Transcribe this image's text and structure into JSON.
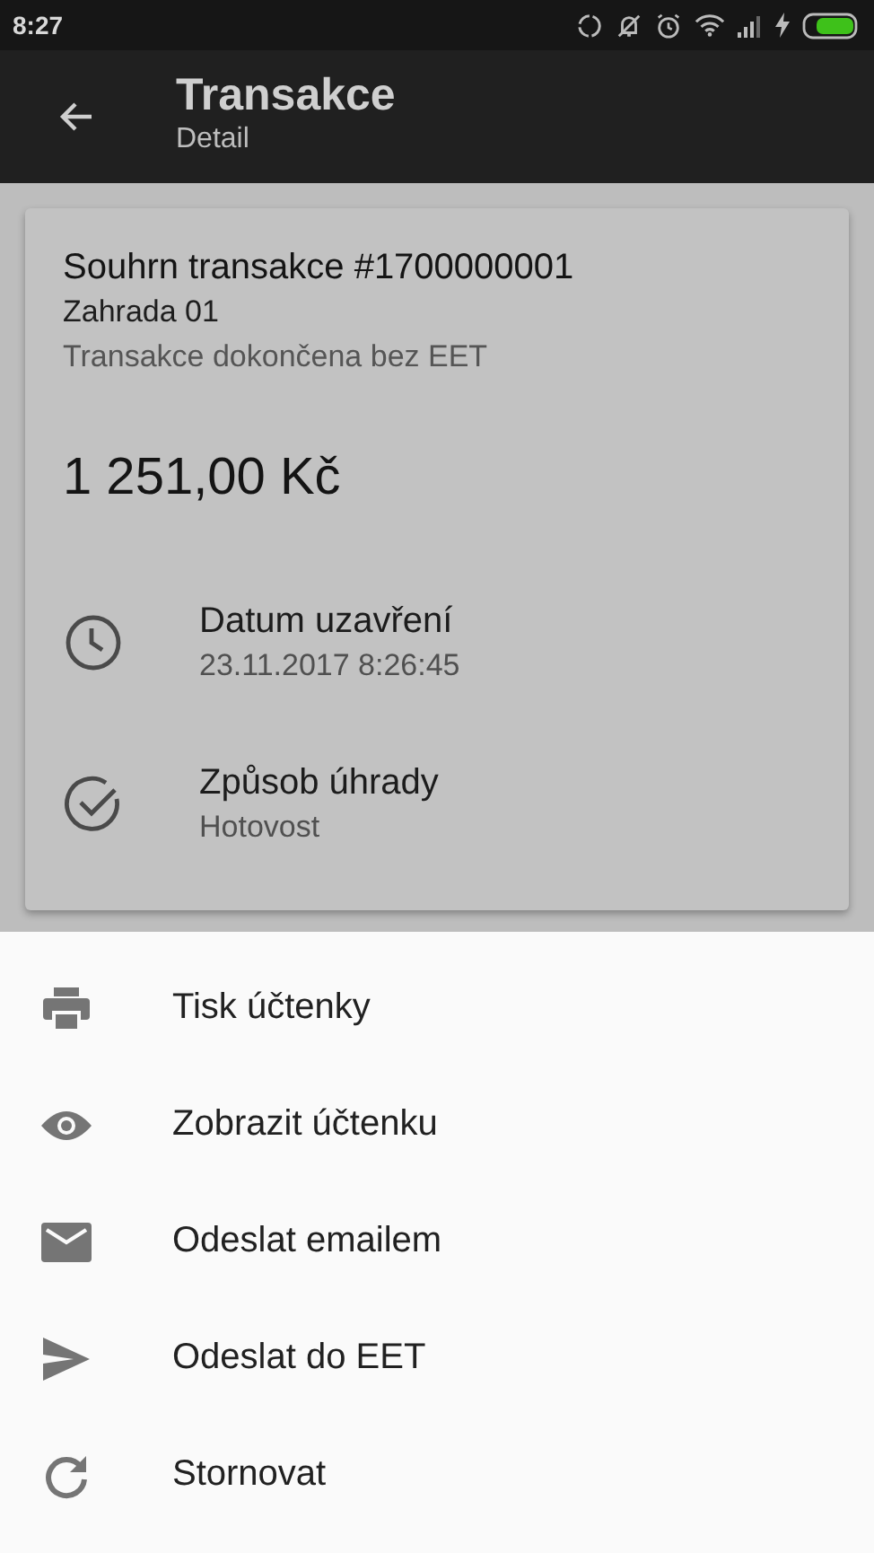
{
  "status_bar": {
    "time": "8:27"
  },
  "app_bar": {
    "title": "Transakce",
    "subtitle": "Detail"
  },
  "summary": {
    "title": "Souhrn transakce #1700000001",
    "place": "Zahrada 01",
    "state": "Transakce dokončena bez EET",
    "amount": "1 251,00 Kč",
    "details": [
      {
        "kind": "date",
        "label": "Datum uzavření",
        "value": "23.11.2017 8:26:45"
      },
      {
        "kind": "payment",
        "label": "Způsob úhrady",
        "value": "Hotovost"
      }
    ]
  },
  "sheet": {
    "items": [
      {
        "kind": "print",
        "label": "Tisk účtenky"
      },
      {
        "kind": "view",
        "label": "Zobrazit účtenku"
      },
      {
        "kind": "email",
        "label": "Odeslat emailem"
      },
      {
        "kind": "send",
        "label": "Odeslat do EET"
      },
      {
        "kind": "cancel",
        "label": "Stornovat"
      }
    ]
  }
}
